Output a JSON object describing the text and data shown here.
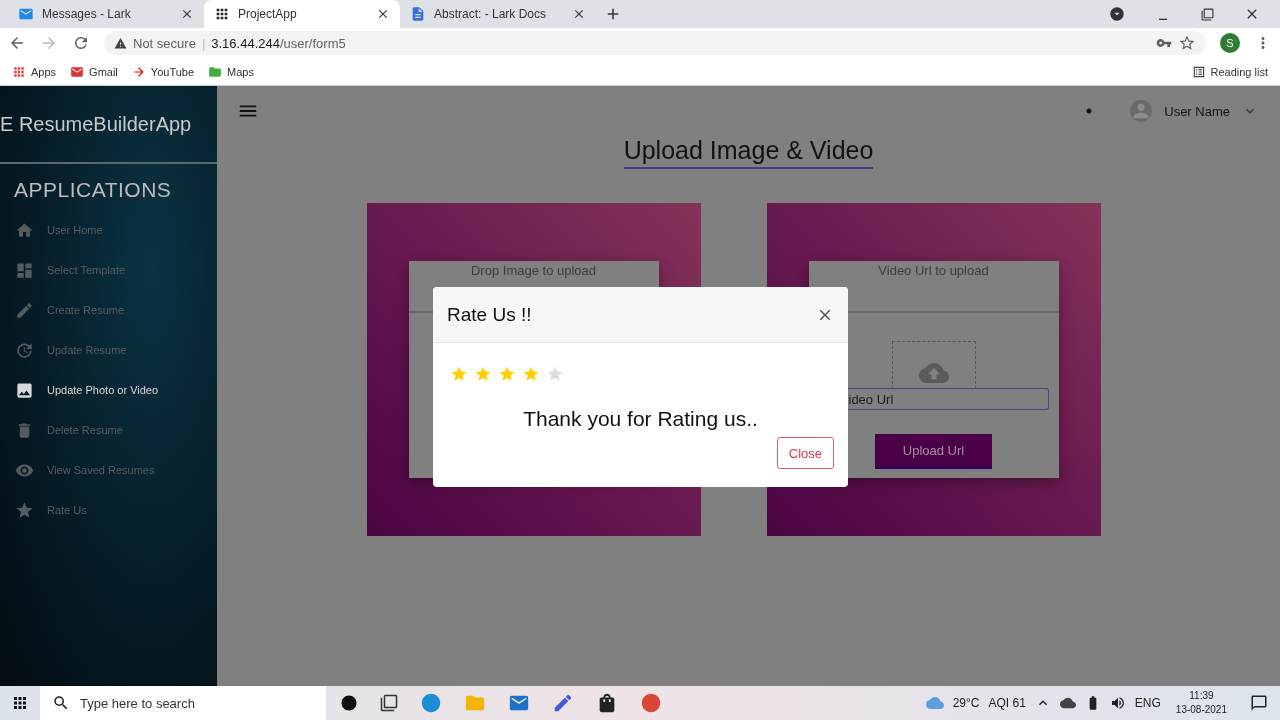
{
  "browser": {
    "tabs": [
      {
        "title": "Messages - Lark",
        "selected": false
      },
      {
        "title": "ProjectApp",
        "selected": true
      },
      {
        "title": "Abstract: - Lark Docs",
        "selected": false
      }
    ],
    "security": "Not secure",
    "separator": "|",
    "url_host": "3.16.44.244",
    "url_path": "/user/form5",
    "profile": "S",
    "bookmarks": [
      "Apps",
      "Gmail",
      "YouTube",
      "Maps"
    ],
    "reading_list": "Reading list"
  },
  "sidebar": {
    "brand": "E ResumeBuilderApp",
    "section": "APPLICATIONS",
    "items": [
      {
        "label": "User Home",
        "selected": false
      },
      {
        "label": "Select Template",
        "selected": false
      },
      {
        "label": "Create Resume",
        "selected": false
      },
      {
        "label": "Update Resume",
        "selected": false
      },
      {
        "label": "Update Photo or Video",
        "selected": true
      },
      {
        "label": "Delete Resume",
        "selected": false
      },
      {
        "label": "View Saved Resumes",
        "selected": false
      },
      {
        "label": "Rate Us",
        "selected": false
      }
    ]
  },
  "header": {
    "user": "User Name"
  },
  "page_title": "Upload Image & Video",
  "cards": [
    {
      "kind": "image",
      "heading": "Drop Image to upload"
    },
    {
      "kind": "video",
      "heading": "Video Url to upload",
      "input_value": "ideo Url",
      "button": "Upload Url"
    }
  ],
  "modal": {
    "title": "Rate Us !!",
    "stars": 4,
    "message": "Thank you for Rating us..",
    "button": "Close"
  },
  "taskbar": {
    "search_placeholder": "Type here to search",
    "temperature": "29°C",
    "aqi": "AQI 61",
    "language": "ENG",
    "time": "11:39",
    "date": "13-08-2021"
  }
}
